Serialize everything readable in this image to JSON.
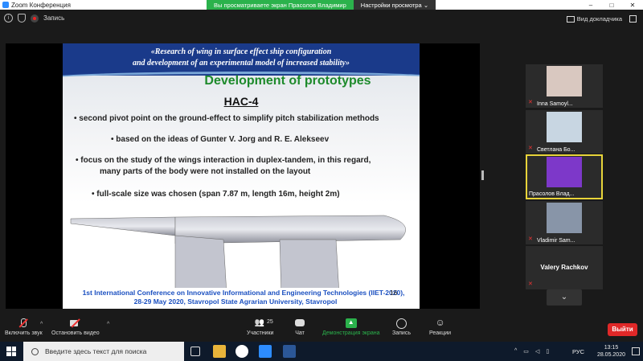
{
  "window": {
    "title": "Zoom Конференция",
    "controls": [
      "–",
      "□",
      "✕"
    ]
  },
  "topbar": {
    "record_label": "Запись",
    "share_banner": "Вы просматриваете экран Прасолов Владимир",
    "view_options": "Настройки просмотра ⌄",
    "view_mode": "Вид докладчика"
  },
  "slide": {
    "header_line1": "«Research of wing in surface effect ship configuration",
    "header_line2": "and development of an experimental model of increased stability»",
    "heading": "Development of prototypes",
    "subheading": "HAC-4",
    "bullets": [
      "• second pivot point on the ground-effect to simplify pitch stabilization methods",
      "• based on the ideas of Gunter V. Jorg and R. E. Alekseev",
      "• focus on the study of the wings interaction in duplex-tandem, in this regard,",
      "many parts of the body were not installed on the layout",
      "• full-scale size was chosen (span 7.87 m, length 16m, height 2m)"
    ],
    "footer_line1": "1st International Conference on Innovative Informational and Engineering Technologies (IIET-2020),",
    "footer_line2": "28-29 May 2020, Stavropol State Agrarian University, Stavropol",
    "page_number": "16"
  },
  "participants": [
    {
      "name": "Inna Samoyl...",
      "muted": true,
      "video_color": "#d9c8c0"
    },
    {
      "name": "Светлана Бо...",
      "muted": true,
      "video_color": "#c8d6e2"
    },
    {
      "name": "Прасолов Влад...",
      "muted": false,
      "video_color": "#7d38c9"
    },
    {
      "name": "Vladimir Sam...",
      "muted": true,
      "video_color": "#8895a8"
    },
    {
      "name": "",
      "display_name": "Valery Rachkov",
      "muted": true
    }
  ],
  "toolbar": {
    "audio": "Включить звук",
    "video": "Остановить видео",
    "participants": "Участники",
    "participants_count": "25",
    "chat": "Чат",
    "share": "Демонстрация экрана",
    "record": "Запись",
    "reactions": "Реакции",
    "leave": "Выйти"
  },
  "taskbar": {
    "search_placeholder": "Введите здесь текст для поиска",
    "language": "РУС",
    "time": "13:15",
    "date": "28.05.2020"
  },
  "colors": {
    "accent_green": "#2bb24c",
    "leave_red": "#e02828",
    "active_speaker": "#e8d43a",
    "slide_heading": "#1d8a2b",
    "slide_header_bg": "#1a3a8a"
  }
}
